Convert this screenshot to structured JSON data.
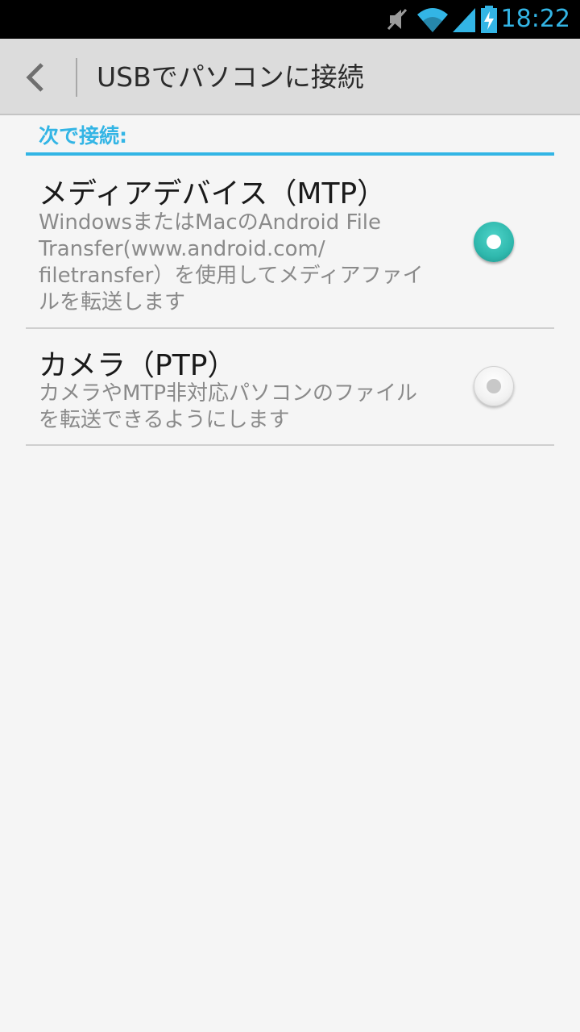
{
  "status_bar": {
    "time": "18:22",
    "icons": [
      "mute-icon",
      "wifi-icon",
      "signal-icon",
      "battery-charging-icon"
    ],
    "accent_color": "#33b5e5"
  },
  "action_bar": {
    "back_icon": "back-chevron-icon",
    "title": "USBでパソコンに接続"
  },
  "section": {
    "header": "次で接続:",
    "accent_color": "#33b5e5"
  },
  "options": [
    {
      "title": "メディアデバイス（MTP）",
      "summary": "WindowsまたはMacのAndroid File Transfer(www.android.com/filetransfer）を使用してメディアファイルを転送します",
      "summary_lines": [
        "WindowsまたはMacのAndroid File",
        "Transfer(www.android.com/",
        "filetransfer）を使用してメディアファイ",
        "ルを転送します"
      ],
      "selected": true,
      "radio_color": "#2fb8ad"
    },
    {
      "title": "カメラ（PTP）",
      "summary": "カメラやMTP非対応パソコンのファイルを転送できるようにします",
      "summary_lines": [
        "カメラやMTP非対応パソコンのファイル",
        "を転送できるようにします"
      ],
      "selected": false
    }
  ]
}
